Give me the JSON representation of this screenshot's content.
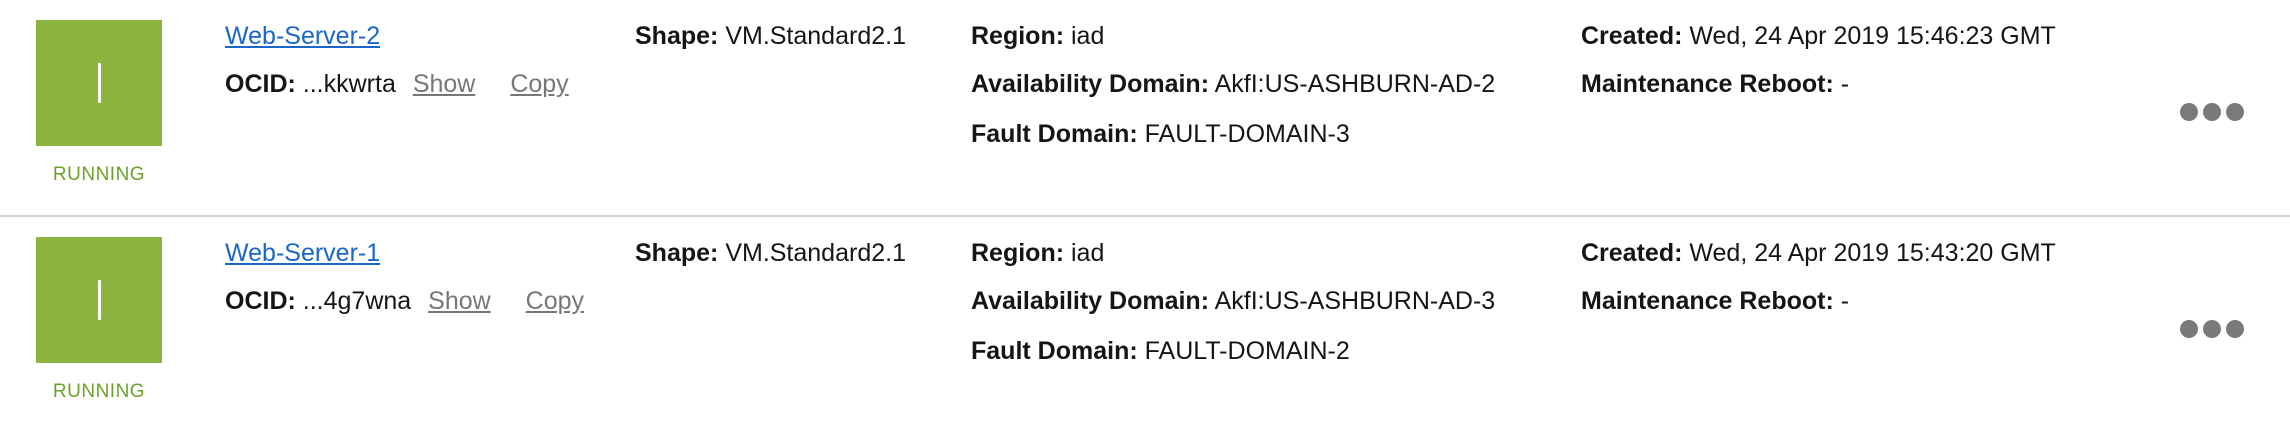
{
  "instances": [
    {
      "name": "Web-Server-2",
      "status": "RUNNING",
      "ocid_label": "OCID:",
      "ocid_value": "...kkwrta",
      "show_label": "Show",
      "copy_label": "Copy",
      "shape_label": "Shape:",
      "shape_value": "VM.Standard2.1",
      "region_label": "Region:",
      "region_value": "iad",
      "ad_label": "Availability Domain:",
      "ad_value": "AkfI:US-ASHBURN-AD-2",
      "fd_label": "Fault Domain:",
      "fd_value": "FAULT-DOMAIN-3",
      "created_label": "Created:",
      "created_value": "Wed, 24 Apr 2019 15:46:23 GMT",
      "maint_label": "Maintenance Reboot:",
      "maint_value": "-"
    },
    {
      "name": "Web-Server-1",
      "status": "RUNNING",
      "ocid_label": "OCID:",
      "ocid_value": "...4g7wna",
      "show_label": "Show",
      "copy_label": "Copy",
      "shape_label": "Shape:",
      "shape_value": "VM.Standard2.1",
      "region_label": "Region:",
      "region_value": "iad",
      "ad_label": "Availability Domain:",
      "ad_value": "AkfI:US-ASHBURN-AD-3",
      "fd_label": "Fault Domain:",
      "fd_value": "FAULT-DOMAIN-2",
      "created_label": "Created:",
      "created_value": "Wed, 24 Apr 2019 15:43:20 GMT",
      "maint_label": "Maintenance Reboot:",
      "maint_value": "-"
    }
  ],
  "icons": {
    "status_tile": "instance-running-icon",
    "actions_menu": "more-actions-icon"
  },
  "colors": {
    "running_tile": "#8bb53e",
    "running_text": "#6ea12a",
    "link": "#1a67c9",
    "secondary_action": "#777777",
    "divider": "#cfcfcf"
  }
}
